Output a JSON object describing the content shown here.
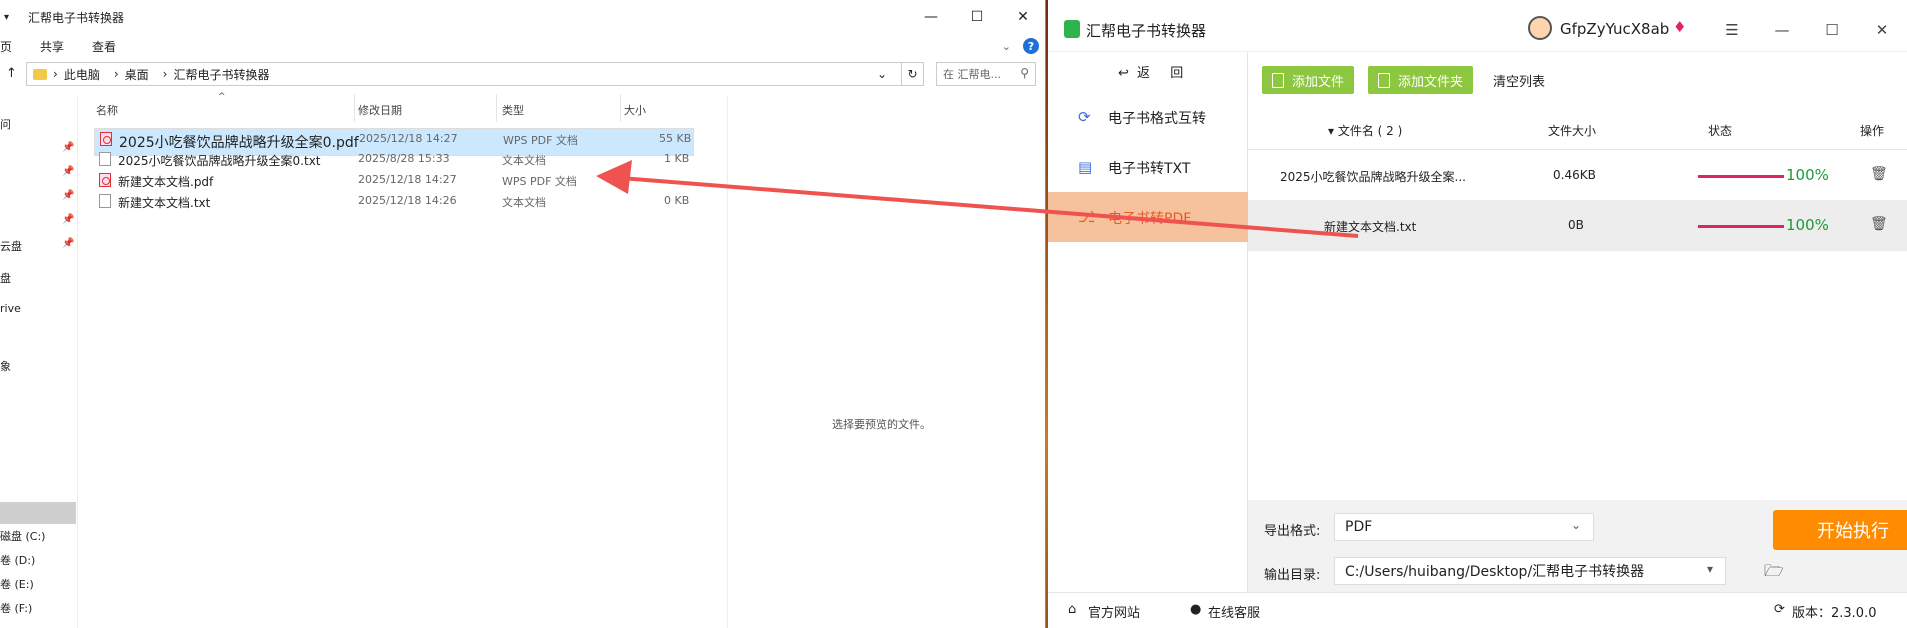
{
  "explorer": {
    "title": "汇帮电子书转换器",
    "controls": {
      "minimize": "—",
      "maximize": "☐",
      "close": "✕"
    },
    "menu": [
      "页",
      "共享",
      "查看"
    ],
    "breadcrumb": [
      "此电脑",
      "桌面",
      "汇帮电子书转换器"
    ],
    "search_placeholder": "在 汇帮电...",
    "nav_items": [
      "问",
      "云盘",
      "盘",
      "rive",
      "象"
    ],
    "drives": [
      "磁盘 (C:)",
      "卷 (D:)",
      "卷 (E:)",
      "卷 (F:)"
    ],
    "columns": [
      "名称",
      "修改日期",
      "类型",
      "大小"
    ],
    "files": [
      {
        "name": "2025小吃餐饮品牌战略升级全案0.pdf",
        "date": "2025/12/18 14:27",
        "type": "WPS PDF 文档",
        "size": "55 KB",
        "icon": "pdf-icon"
      },
      {
        "name": "2025小吃餐饮品牌战略升级全案0.txt",
        "date": "2025/8/28 15:33",
        "type": "文本文档",
        "size": "1 KB",
        "icon": "txt-icon"
      },
      {
        "name": "新建文本文档.pdf",
        "date": "2025/12/18 14:27",
        "type": "WPS PDF 文档",
        "size": "",
        "icon": "pdf-icon"
      },
      {
        "name": "新建文本文档.txt",
        "date": "2025/12/18 14:26",
        "type": "文本文档",
        "size": "0 KB",
        "icon": "txt-icon"
      }
    ],
    "preview_text": "选择要预览的文件。"
  },
  "converter": {
    "title": "汇帮电子书转换器",
    "username": "GfpZyYucX8ab",
    "controls": {
      "menu": "☰",
      "minimize": "—",
      "maximize": "☐",
      "close": "✕"
    },
    "back_label": "返",
    "back_label2": "回",
    "sidebar": [
      {
        "label": "电子书格式互转",
        "icon": "convert-icon"
      },
      {
        "label": "电子书转TXT",
        "icon": "document-icon"
      },
      {
        "label": "电子书转PDF",
        "icon": "pdf-icon"
      }
    ],
    "toolbar": {
      "add_file": "添加文件",
      "add_folder": "添加文件夹",
      "clear": "清空列表"
    },
    "table": {
      "headers": [
        "▾ 文件名 ( 2 )",
        "文件大小",
        "状态",
        "操作"
      ],
      "rows": [
        {
          "name": "2025小吃餐饮品牌战略升级全案...",
          "size": "0.46KB",
          "progress": 1.0,
          "status": "100%"
        },
        {
          "name": "新建文本文档.txt",
          "size": "0B",
          "progress": 1.0,
          "status": "100%"
        }
      ]
    },
    "export_label": "导出格式:",
    "export_value": "PDF",
    "output_label": "输出目录:",
    "output_value": "C:/Users/huibang/Desktop/汇帮电子书转换器",
    "start_label": "开始执行",
    "footer": {
      "website": "官方网站",
      "service": "在线客服",
      "version": "版本：2.3.0.0"
    }
  },
  "colors": {
    "accent_green": "#8dc63f",
    "accent_orange": "#ff8c00",
    "active_tab": "#f6c29e",
    "arrow": "#ef5350",
    "progress": "#e0245e",
    "percent": "#1a9c3a"
  }
}
